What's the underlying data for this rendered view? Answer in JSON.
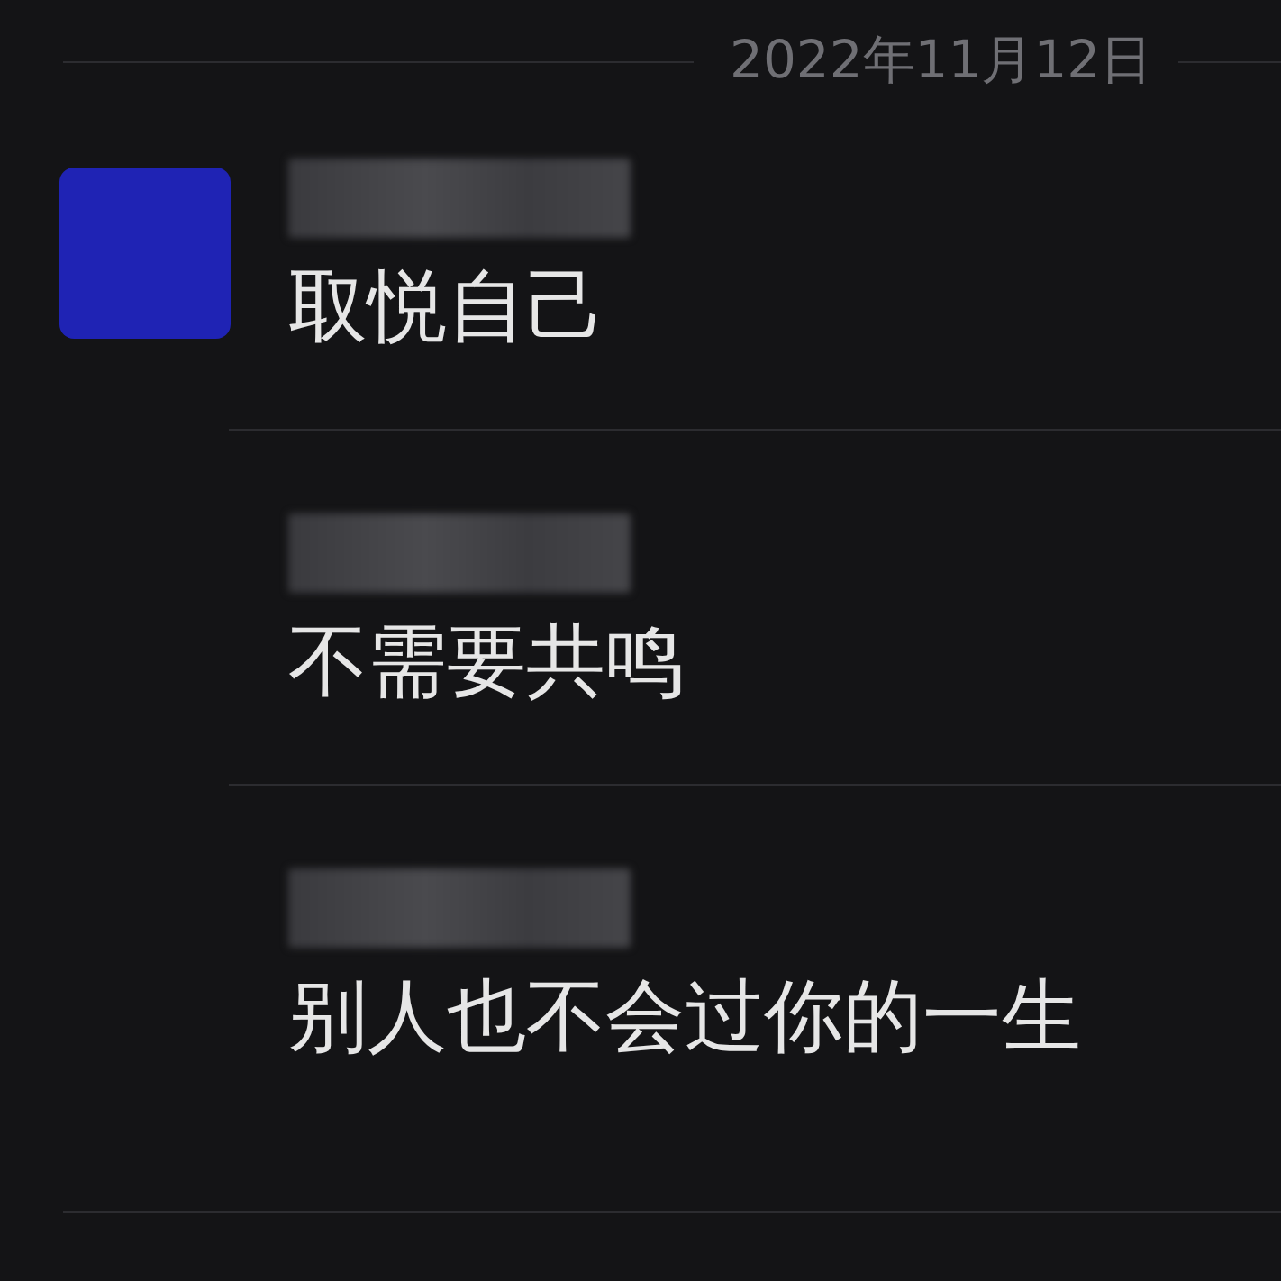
{
  "date_header": "2022年11月12日",
  "messages": [
    {
      "text": "取悦自己",
      "show_avatar": true
    },
    {
      "text": "不需要共鸣",
      "show_avatar": false
    },
    {
      "text": "别人也不会过你的一生",
      "show_avatar": false
    }
  ]
}
